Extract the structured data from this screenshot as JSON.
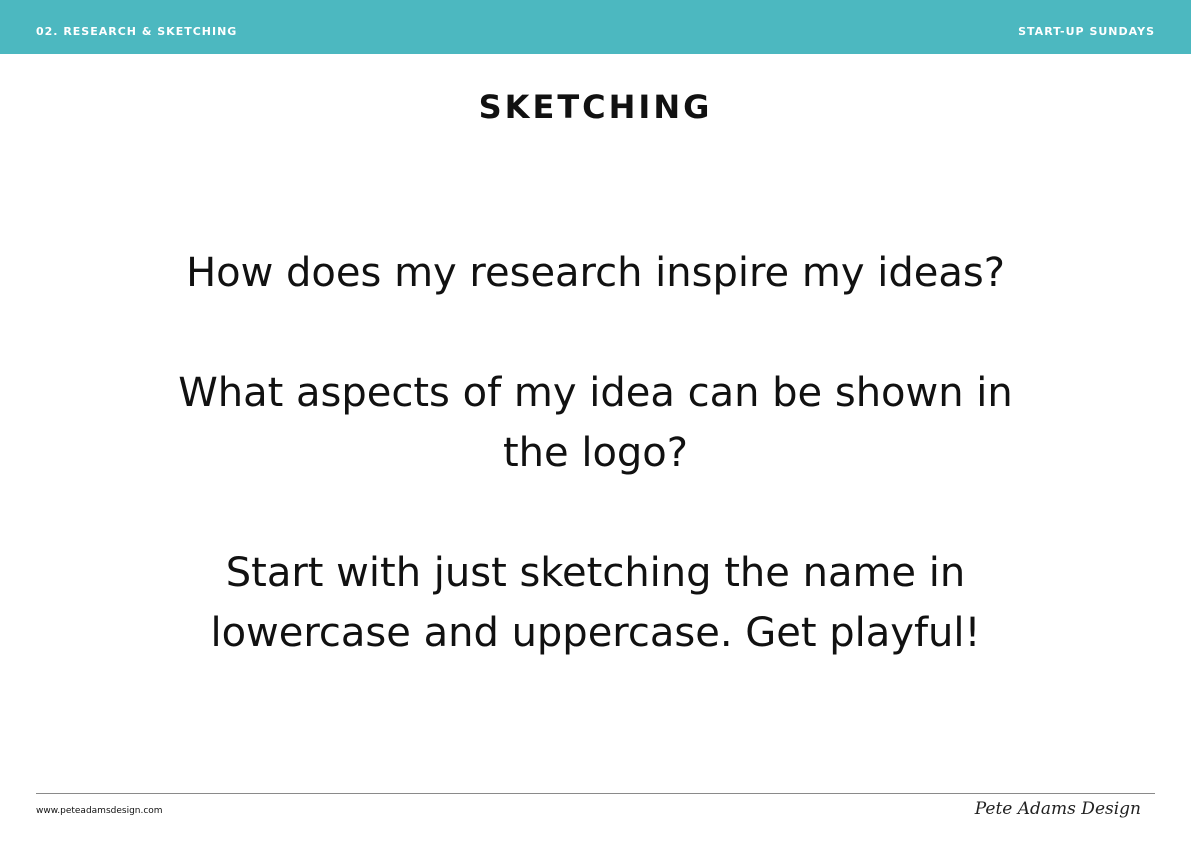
{
  "header": {
    "section_label": "02. RESEARCH & SKETCHING",
    "series_label": "START-UP SUNDAYS",
    "bar_color": "#4cb8c0"
  },
  "slide": {
    "title": "SKETCHING",
    "questions": [
      "How does my research inspire my ideas?",
      "What aspects of my idea can be shown in the logo?",
      "Start with just sketching the name in lowercase and uppercase. Get playful!"
    ]
  },
  "footer": {
    "website": "www.peteadamsdesign.com",
    "signature": "Pete Adams Design"
  }
}
